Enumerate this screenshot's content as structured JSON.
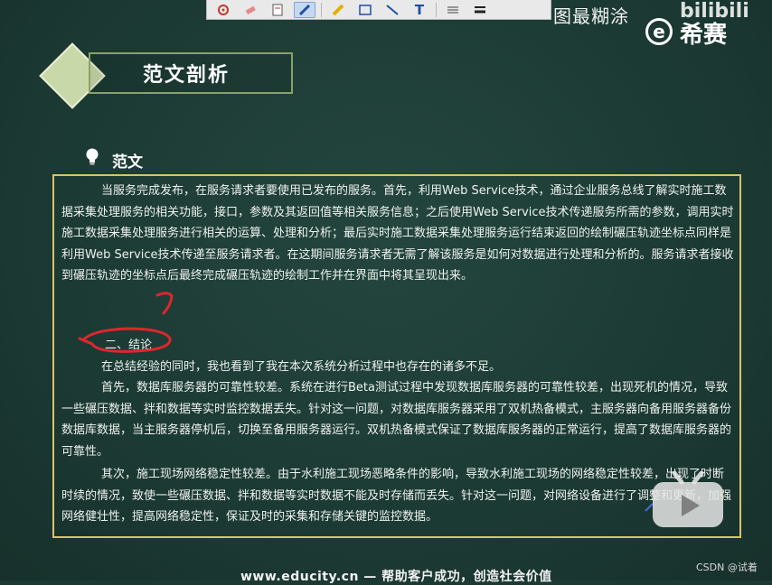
{
  "toolbar": {
    "text_tool_label": "T",
    "right_text": "图最糊涂"
  },
  "logo": {
    "letter": "e",
    "brand": "希赛",
    "watermark": "bilibili"
  },
  "title": "范文剖析",
  "section_label": "范文",
  "paragraphs": {
    "p1": "当服务完成发布，在服务请求者要使用已发布的服务。首先，利用Web Service技术，通过企业服务总线了解实时施工数据采集处理服务的相关功能，接口，参数及其返回值等相关服务信息；之后使用Web Service技术传递服务所需的参数，调用实时施工数据采集处理服务进行相关的运算、处理和分析；最后实时施工数据采集处理服务运行结束返回的绘制碾压轨迹坐标点同样是利用Web Service技术传递至服务请求者。在这期间服务请求者无需了解该服务是如何对数据进行处理和分析的。服务请求者接收到碾压轨迹的坐标点后最终完成碾压轨迹的绘制工作并在界面中将其呈现出来。",
    "conclusion_heading": "二、结论",
    "p2": "在总结经验的同时，我也看到了我在本次系统分析过程中也存在的诸多不足。",
    "p3": "首先，数据库服务器的可靠性较差。系统在进行Beta测试过程中发现数据库服务器的可靠性较差，出现死机的情况，导致一些碾压数据、拌和数据等实时监控数据丢失。针对这一问题，对数据库服务器采用了双机热备模式，主服务器向备用服务器备份数据库数据，当主服务器停机后，切换至备用服务器运行。双机热备模式保证了数据库服务器的正常运行，提高了数据库服务器的可靠性。",
    "p4": "其次，施工现场网络稳定性较差。由于水利施工现场恶略条件的影响，导致水利施工现场的网络稳定性较差，出现了时断时续的情况，致使一些碾压数据、拌和数据等实时数据不能及时存储而丢失。针对这一问题，对网络设备进行了调整和更新，加强网络健壮性，提高网络稳定性，保证及时的采集和存储关键的监控数据。"
  },
  "footer": "www.educity.cn — 帮助客户成功，创造社会价值",
  "csdn_watermark": "CSDN @试着",
  "colors": {
    "background": "#1c3a34",
    "box_border": "#d8c46a",
    "diamond": "#c8d8a8",
    "annotation_red": "#e0262c"
  }
}
